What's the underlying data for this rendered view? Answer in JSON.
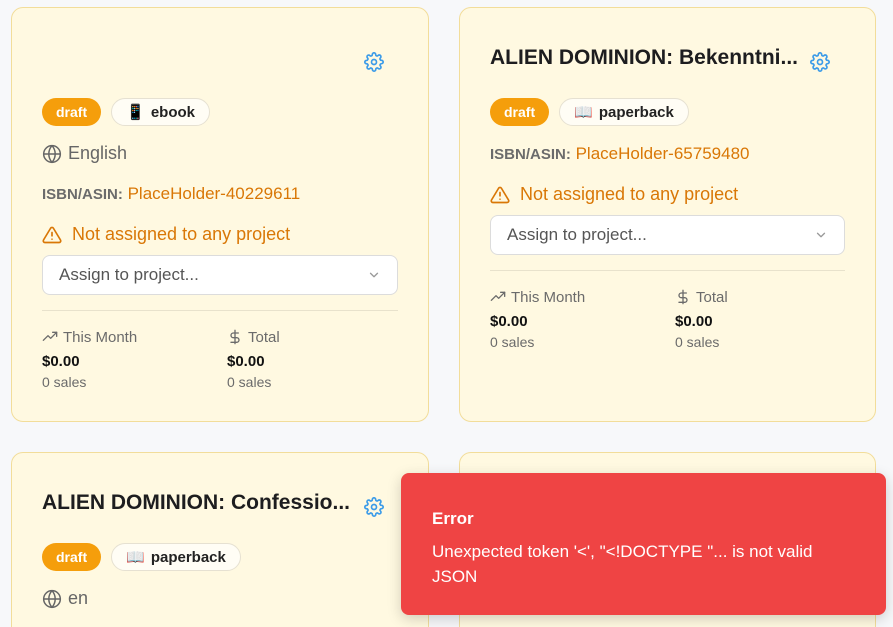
{
  "cards": [
    {
      "title": "",
      "status": "draft",
      "format_icon": "tablet-icon",
      "format_glyph": "📱",
      "format": "ebook",
      "language": "English",
      "isbn_label": "ISBN/ASIN:",
      "isbn_value": "PlaceHolder-40229611",
      "warning": "Not assigned to any project",
      "assign_placeholder": "Assign to project...",
      "this_month_label": "This Month",
      "this_month_amount": "$0.00",
      "this_month_sales": "0 sales",
      "total_label": "Total",
      "total_amount": "$0.00",
      "total_sales": "0 sales"
    },
    {
      "title": "ALIEN DOMINION: Bekenntni...",
      "status": "draft",
      "format_icon": "book-icon",
      "format_glyph": "📖",
      "format": "paperback",
      "isbn_label": "ISBN/ASIN:",
      "isbn_value": "PlaceHolder-65759480",
      "warning": "Not assigned to any project",
      "assign_placeholder": "Assign to project...",
      "this_month_label": "This Month",
      "this_month_amount": "$0.00",
      "this_month_sales": "0 sales",
      "total_label": "Total",
      "total_amount": "$0.00",
      "total_sales": "0 sales"
    },
    {
      "title": "ALIEN DOMINION: Confessio...",
      "status": "draft",
      "format_icon": "book-icon",
      "format_glyph": "📖",
      "format": "paperback",
      "language": "en"
    }
  ],
  "toast": {
    "title": "Error",
    "message": "Unexpected token '<', \"<!DOCTYPE \"... is not valid JSON"
  },
  "colors": {
    "accent": "#d97706",
    "status_badge": "#f59e0b",
    "gear": "#3b9be8",
    "error": "#ef4444",
    "card_bg": "#fff9e1"
  }
}
